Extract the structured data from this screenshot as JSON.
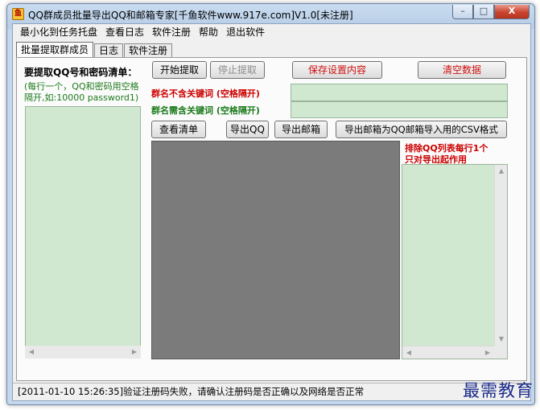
{
  "window": {
    "title": "QQ群成员批量导出QQ和邮箱专家[千鱼软件www.917e.com]V1.0[未注册]",
    "app_icon_text": "鱼",
    "controls": [
      "–",
      "□",
      "X"
    ]
  },
  "menu": [
    "最小化到任务托盘",
    "查看日志",
    "软件注册",
    "帮助",
    "退出软件"
  ],
  "tabs": [
    "批量提取群成员",
    "日志",
    "软件注册"
  ],
  "left": {
    "heading": "要提取QQ号和密码清单：",
    "hint_line1": "(每行一个，QQ和密码用空格",
    "hint_line2": "隔开,如:10000  password1)"
  },
  "buttons": {
    "start": "开始提取",
    "stop": "停止提取",
    "save_settings": "保存设置内容",
    "clear_data": "清空数据",
    "view_list": "查看清单",
    "export_qq": "导出QQ",
    "export_email": "导出邮箱",
    "export_csv": "导出邮箱为QQ邮箱导入用的CSV格式"
  },
  "keywords": {
    "exclude_label": "群名不含关键词 (空格隔开)",
    "include_label": "群名需含关键词 (空格隔开)"
  },
  "right": {
    "exclude_note_line1": "排除QQ列表每行1个",
    "exclude_note_line2": "只对导出起作用"
  },
  "status": {
    "message": "[2011-01-10 15:26:35]验证注册码失败，请确认注册码是否正确以及网络是否正常"
  },
  "watermark": "最需教育"
}
